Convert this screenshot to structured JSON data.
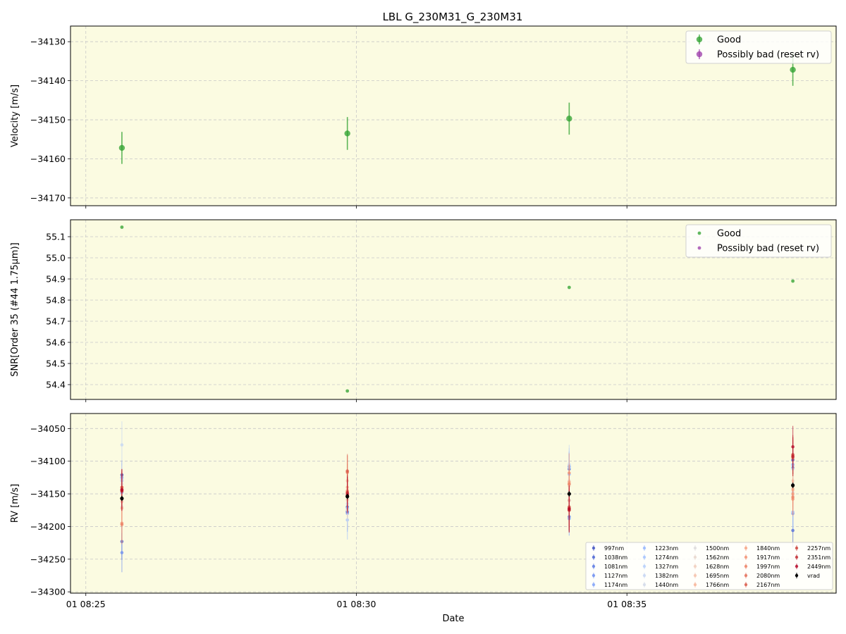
{
  "title": "LBL G_230M31_G_230M31",
  "colors": {
    "panel_bg": "#fbfbe1",
    "good": "#2ca02c",
    "bad": "#9b3aa8",
    "grid": "#c8c8c8",
    "vrad": "#000000"
  },
  "chart_data": [
    {
      "type": "scatter",
      "panel": "velocity",
      "ylabel": "Velocity [m/s]",
      "xlabel": "",
      "ylim": [
        -34172,
        -34126
      ],
      "yticks": [
        -34130,
        -34140,
        -34150,
        -34160,
        -34170
      ],
      "ytick_labels": [
        "−34130",
        "−34140",
        "−34150",
        "−34160",
        "−34170"
      ],
      "legend_position": "top-right",
      "legend": [
        "Good",
        "Possibly bad (reset rv)"
      ],
      "series": [
        {
          "name": "Good",
          "x": [
            "08:25:40",
            "08:29:50",
            "08:33:56",
            "08:38:04"
          ],
          "y": [
            -34157.2,
            -34153.5,
            -34149.7,
            -34137.2
          ],
          "yerr": [
            4.1,
            4.2,
            4.1,
            4.1
          ]
        },
        {
          "name": "Possibly bad (reset rv)",
          "x": [],
          "y": [],
          "yerr": []
        }
      ]
    },
    {
      "type": "scatter",
      "panel": "snr",
      "ylabel": "SNR[Order 35 (#44 1.75μm)]",
      "xlabel": "",
      "ylim": [
        54.33,
        55.18
      ],
      "yticks": [
        55.1,
        55.0,
        54.9,
        54.8,
        54.7,
        54.6,
        54.5,
        54.4
      ],
      "ytick_labels": [
        "55.1",
        "55.0",
        "54.9",
        "54.8",
        "54.7",
        "54.6",
        "54.5",
        "54.4"
      ],
      "legend_position": "top-right",
      "legend": [
        "Good",
        "Possibly bad (reset rv)"
      ],
      "series": [
        {
          "name": "Good",
          "x": [
            "08:25:40",
            "08:29:50",
            "08:33:56",
            "08:38:04"
          ],
          "y": [
            55.145,
            54.37,
            54.86,
            54.89
          ]
        },
        {
          "name": "Possibly bad (reset rv)",
          "x": [],
          "y": []
        }
      ]
    },
    {
      "type": "scatter",
      "panel": "rv",
      "ylabel": "RV [m/s]",
      "xlabel": "Date",
      "ylim": [
        -34302,
        -34027
      ],
      "yticks": [
        -34050,
        -34100,
        -34150,
        -34200,
        -34250,
        -34300
      ],
      "ytick_labels": [
        "−34050",
        "−34100",
        "−34150",
        "−34200",
        "−34250",
        "−34300"
      ],
      "x_ticks": [
        "08:25:00",
        "08:30:00",
        "08:35:00"
      ],
      "x_tick_labels": [
        "01 08:25",
        "01 08:30",
        "01 08:35"
      ],
      "x_range": [
        "08:24:43",
        "08:38:52"
      ],
      "legend_position": "lower-right",
      "legend_columns": 5,
      "x": [
        "08:25:40",
        "08:29:50",
        "08:33:56",
        "08:38:04"
      ],
      "series": [
        {
          "name": "997nm",
          "color": "#3b4cc0",
          "y": [
            -34121,
            -34177,
            -34108,
            -34098
          ],
          "yerr": [
            22,
            28,
            22,
            22
          ]
        },
        {
          "name": "1038nm",
          "color": "#4961d2",
          "y": [
            -34223,
            -34170,
            -34112,
            -34206
          ],
          "yerr": [
            28,
            30,
            24,
            26
          ]
        },
        {
          "name": "1081nm",
          "color": "#5a78e4",
          "y": [
            -34125,
            -34178,
            -34185,
            -34110
          ],
          "yerr": [
            22,
            26,
            22,
            22
          ]
        },
        {
          "name": "1127nm",
          "color": "#6b8df0",
          "y": [
            -34240,
            -34171,
            -34160,
            -34180
          ],
          "yerr": [
            30,
            30,
            25,
            28
          ]
        },
        {
          "name": "1174nm",
          "color": "#7ea1f9",
          "y": [
            -34130,
            -34180,
            -34188,
            -34105
          ],
          "yerr": [
            24,
            28,
            26,
            24
          ]
        },
        {
          "name": "1223nm",
          "color": "#92b4fe",
          "y": [
            -34148,
            -34175,
            -34120,
            -34178
          ],
          "yerr": [
            24,
            28,
            26,
            25
          ]
        },
        {
          "name": "1274nm",
          "color": "#a3c2fe",
          "y": [
            -34125,
            -34190,
            -34110,
            -34106
          ],
          "yerr": [
            24,
            30,
            26,
            24
          ]
        },
        {
          "name": "1327nm",
          "color": "#b4cefb",
          "y": [
            -34127,
            -34172,
            -34108,
            -34178
          ],
          "yerr": [
            26,
            30,
            28,
            26
          ]
        },
        {
          "name": "1382nm",
          "color": "#c4d5f3",
          "y": [
            -34075,
            -34165,
            -34105,
            -34112
          ],
          "yerr": [
            36,
            32,
            30,
            30
          ]
        },
        {
          "name": "1440nm",
          "color": "#d1dae9",
          "y": [
            -34130,
            -34150,
            -34160,
            -34148
          ],
          "yerr": [
            30,
            30,
            28,
            26
          ]
        },
        {
          "name": "1500nm",
          "color": "#dddcdc",
          "y": [
            -34135,
            -34175,
            -34170,
            -34135
          ],
          "yerr": [
            28,
            30,
            28,
            26
          ]
        },
        {
          "name": "1562nm",
          "color": "#e7d7cd",
          "y": [
            -34170,
            -34160,
            -34130,
            -34152
          ],
          "yerr": [
            26,
            28,
            26,
            24
          ]
        },
        {
          "name": "1628nm",
          "color": "#f0cdbb",
          "y": [
            -34160,
            -34158,
            -34138,
            -34130
          ],
          "yerr": [
            28,
            28,
            28,
            24
          ]
        },
        {
          "name": "1695nm",
          "color": "#f5c1a9",
          "y": [
            -34162,
            -34130,
            -34135,
            -34142
          ],
          "yerr": [
            28,
            26,
            28,
            24
          ]
        },
        {
          "name": "1766nm",
          "color": "#f7b396",
          "y": [
            -34172,
            -34140,
            -34160,
            -34144
          ],
          "yerr": [
            28,
            28,
            28,
            26
          ]
        },
        {
          "name": "1840nm",
          "color": "#f6a283",
          "y": [
            -34140,
            -34145,
            -34132,
            -34150
          ],
          "yerr": [
            26,
            26,
            26,
            24
          ]
        },
        {
          "name": "1917nm",
          "color": "#f29072",
          "y": [
            -34195,
            -34146,
            -34118,
            -34158
          ],
          "yerr": [
            30,
            28,
            30,
            26
          ]
        },
        {
          "name": "1997nm",
          "color": "#ec7f63",
          "y": [
            -34197,
            -34148,
            -34135,
            -34155
          ],
          "yerr": [
            30,
            28,
            30,
            26
          ]
        },
        {
          "name": "2080nm",
          "color": "#e36c55",
          "y": [
            -34145,
            -34117,
            -34175,
            -34095
          ],
          "yerr": [
            28,
            26,
            30,
            28
          ]
        },
        {
          "name": "2167nm",
          "color": "#d95847",
          "y": [
            -34140,
            -34115,
            -34170,
            -34092
          ],
          "yerr": [
            28,
            26,
            30,
            28
          ]
        },
        {
          "name": "2257nm",
          "color": "#cc403a",
          "y": [
            -34143,
            -34148,
            -34172,
            -34090
          ],
          "yerr": [
            30,
            28,
            34,
            30
          ]
        },
        {
          "name": "2351nm",
          "color": "#c0282f",
          "y": [
            -34146,
            -34150,
            -34175,
            -34093
          ],
          "yerr": [
            30,
            28,
            34,
            30
          ]
        },
        {
          "name": "2449nm",
          "color": "#b40426",
          "y": [
            -34144,
            -34152,
            -34173,
            -34078
          ],
          "yerr": [
            32,
            28,
            36,
            32
          ]
        },
        {
          "name": "vrad",
          "color": "#000000",
          "y": [
            -34157,
            -34154,
            -34150,
            -34137
          ],
          "yerr": [
            4,
            4,
            4,
            4
          ]
        }
      ]
    }
  ]
}
